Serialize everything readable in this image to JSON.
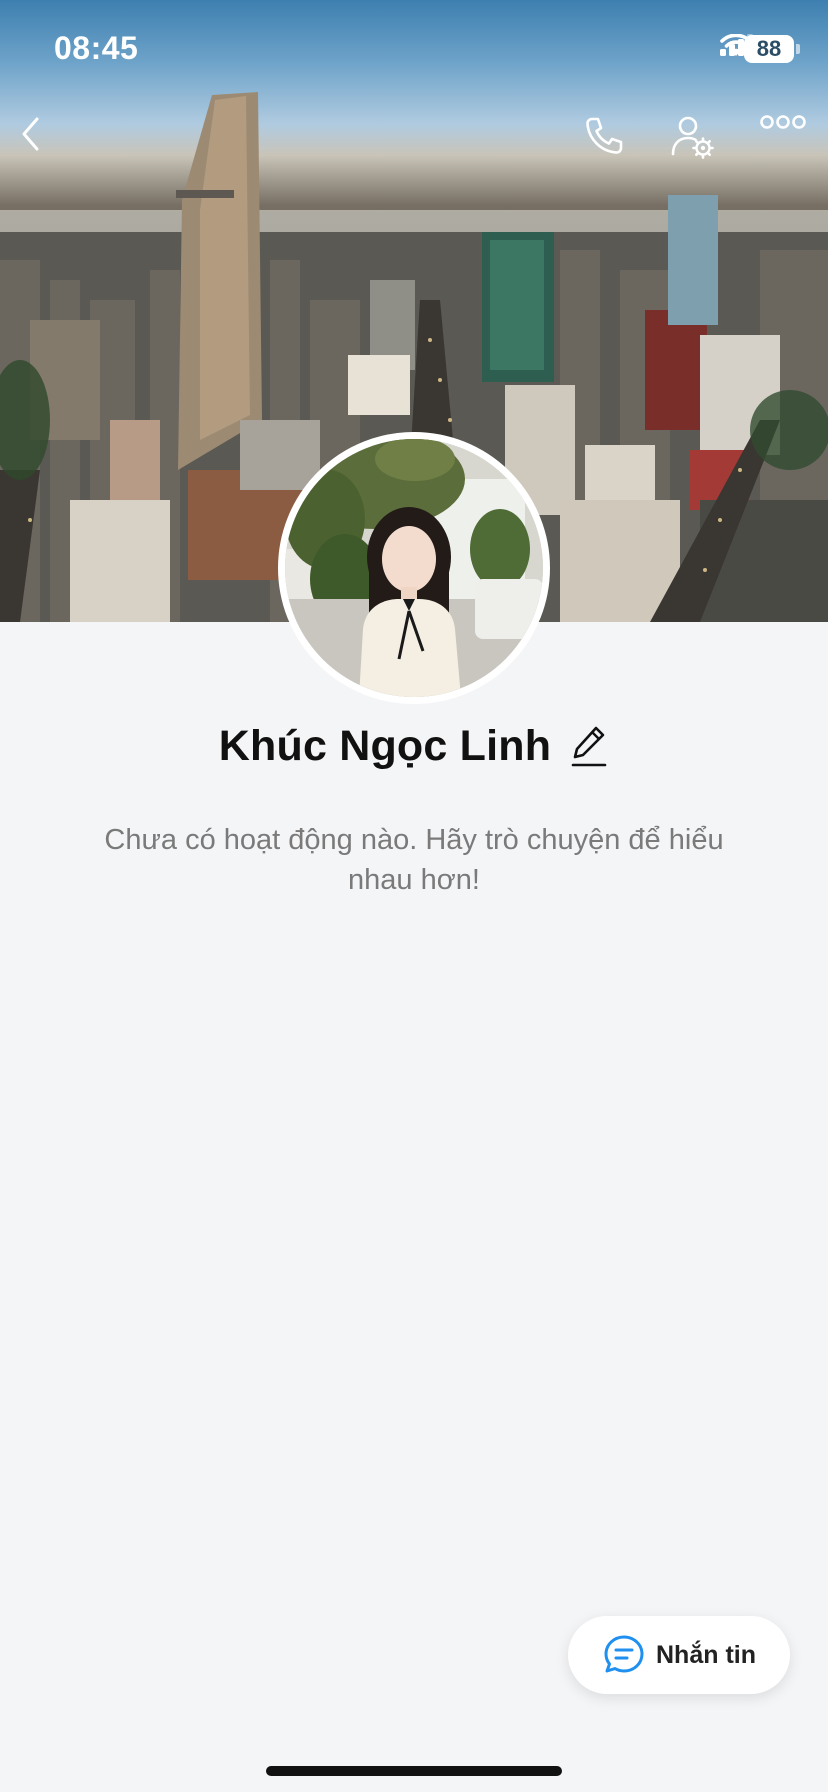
{
  "status_bar": {
    "time": "08:45",
    "battery": "88",
    "icons": [
      "signal-icon",
      "wifi-icon",
      "battery-icon"
    ]
  },
  "nav": {
    "icons": [
      "back-icon",
      "phone-icon",
      "user-settings-icon",
      "more-icon"
    ]
  },
  "profile": {
    "name": "Khúc Ngọc Linh",
    "empty_message": "Chưa có hoạt động nào. Hãy trò chuyện để hiểu nhau hơn!"
  },
  "actions": {
    "message_label": "Nhắn tin",
    "message_icon": "chat-bubble-icon"
  },
  "colors": {
    "background": "#f4f5f7",
    "accent": "#1f8ff0",
    "text_primary": "#111111",
    "text_secondary": "#7a7a7a"
  }
}
